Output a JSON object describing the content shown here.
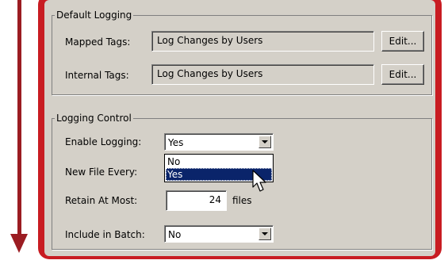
{
  "default_logging": {
    "legend": "Default Logging",
    "mapped_tags": {
      "label": "Mapped Tags:",
      "value": "Log Changes by Users",
      "edit_label": "Edit..."
    },
    "internal_tags": {
      "label": "Internal Tags:",
      "value": "Log Changes by Users",
      "edit_label": "Edit..."
    }
  },
  "logging_control": {
    "legend": "Logging Control",
    "enable_logging": {
      "label": "Enable Logging:",
      "value": "Yes",
      "options": [
        "No",
        "Yes"
      ],
      "highlighted": "Yes"
    },
    "new_file_every": {
      "label": "New File Every:"
    },
    "retain_at_most": {
      "label": "Retain At Most:",
      "value": "24",
      "unit": "files"
    },
    "include_in_batch": {
      "label": "Include in Batch:",
      "value": "No"
    }
  },
  "colors": {
    "accent_red": "#c81c22",
    "arrow": "#9b1c22",
    "selection": "#0a246a",
    "panel": "#d4d0c8"
  }
}
